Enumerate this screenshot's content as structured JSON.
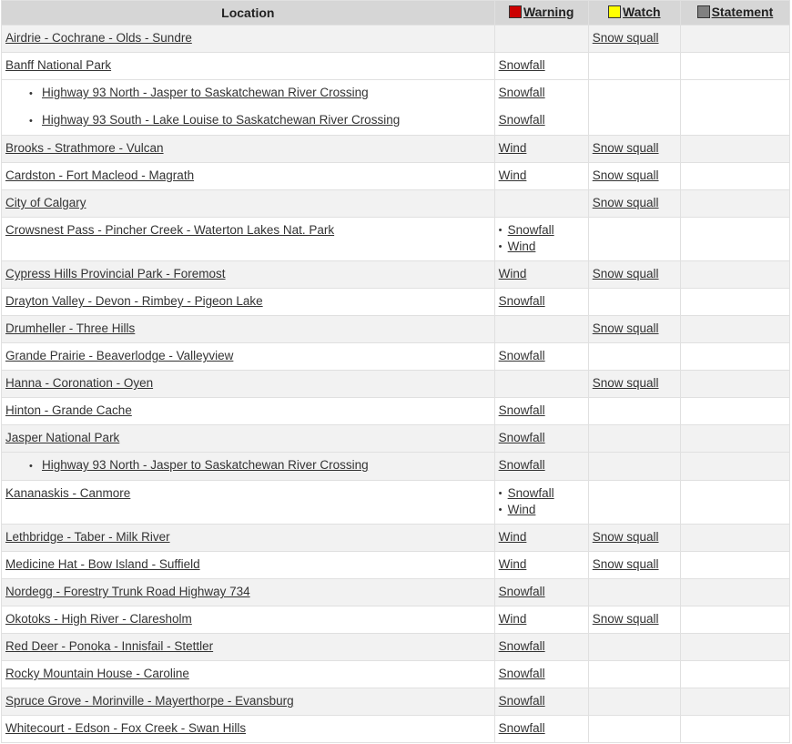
{
  "header": {
    "location": "Location",
    "warning": "Warning",
    "watch": "Watch",
    "statement": "Statement",
    "colors": {
      "warning": "#cc0000",
      "watch": "#ffff00",
      "statement": "#808080"
    }
  },
  "rows": [
    {
      "loc": "Airdrie - Cochrane - Olds - Sundre",
      "sub": false,
      "warning": [],
      "watch": [
        "Snow squall"
      ]
    },
    {
      "loc": "Banff National Park",
      "sub": false,
      "warning": [
        "Snowfall"
      ],
      "watch": []
    },
    {
      "loc": "Highway 93 North - Jasper to Saskatchewan River Crossing",
      "sub": true,
      "warning": [
        "Snowfall"
      ],
      "watch": []
    },
    {
      "loc": "Highway 93 South - Lake Louise to Saskatchewan River Crossing",
      "sub": true,
      "warning": [
        "Snowfall"
      ],
      "watch": []
    },
    {
      "loc": "Brooks - Strathmore - Vulcan",
      "sub": false,
      "warning": [
        "Wind"
      ],
      "watch": [
        "Snow squall"
      ]
    },
    {
      "loc": "Cardston - Fort Macleod - Magrath",
      "sub": false,
      "warning": [
        "Wind"
      ],
      "watch": [
        "Snow squall"
      ]
    },
    {
      "loc": "City of Calgary",
      "sub": false,
      "warning": [],
      "watch": [
        "Snow squall"
      ]
    },
    {
      "loc": "Crowsnest Pass - Pincher Creek - Waterton Lakes Nat. Park",
      "sub": false,
      "warning": [
        "Snowfall",
        "Wind"
      ],
      "watch": []
    },
    {
      "loc": "Cypress Hills Provincial Park - Foremost",
      "sub": false,
      "warning": [
        "Wind"
      ],
      "watch": [
        "Snow squall"
      ]
    },
    {
      "loc": "Drayton Valley - Devon - Rimbey - Pigeon Lake",
      "sub": false,
      "warning": [
        "Snowfall"
      ],
      "watch": []
    },
    {
      "loc": "Drumheller - Three Hills",
      "sub": false,
      "warning": [],
      "watch": [
        "Snow squall"
      ]
    },
    {
      "loc": "Grande Prairie - Beaverlodge - Valleyview",
      "sub": false,
      "warning": [
        "Snowfall"
      ],
      "watch": []
    },
    {
      "loc": "Hanna - Coronation - Oyen",
      "sub": false,
      "warning": [],
      "watch": [
        "Snow squall"
      ]
    },
    {
      "loc": "Hinton - Grande Cache",
      "sub": false,
      "warning": [
        "Snowfall"
      ],
      "watch": []
    },
    {
      "loc": "Jasper National Park",
      "sub": false,
      "warning": [
        "Snowfall"
      ],
      "watch": []
    },
    {
      "loc": "Highway 93 North - Jasper to Saskatchewan River Crossing",
      "sub": true,
      "warning": [
        "Snowfall"
      ],
      "watch": []
    },
    {
      "loc": "Kananaskis - Canmore",
      "sub": false,
      "warning": [
        "Snowfall",
        "Wind"
      ],
      "watch": []
    },
    {
      "loc": "Lethbridge - Taber - Milk River",
      "sub": false,
      "warning": [
        "Wind"
      ],
      "watch": [
        "Snow squall"
      ]
    },
    {
      "loc": "Medicine Hat - Bow Island - Suffield",
      "sub": false,
      "warning": [
        "Wind"
      ],
      "watch": [
        "Snow squall"
      ]
    },
    {
      "loc": "Nordegg - Forestry Trunk Road Highway 734",
      "sub": false,
      "warning": [
        "Snowfall"
      ],
      "watch": []
    },
    {
      "loc": "Okotoks - High River - Claresholm",
      "sub": false,
      "warning": [
        "Wind"
      ],
      "watch": [
        "Snow squall"
      ]
    },
    {
      "loc": "Red Deer - Ponoka - Innisfail - Stettler",
      "sub": false,
      "warning": [
        "Snowfall"
      ],
      "watch": []
    },
    {
      "loc": "Rocky Mountain House - Caroline",
      "sub": false,
      "warning": [
        "Snowfall"
      ],
      "watch": []
    },
    {
      "loc": "Spruce Grove - Morinville - Mayerthorpe - Evansburg",
      "sub": false,
      "warning": [
        "Snowfall"
      ],
      "watch": []
    },
    {
      "loc": "Whitecourt - Edson - Fox Creek - Swan Hills",
      "sub": false,
      "warning": [
        "Snowfall"
      ],
      "watch": []
    }
  ]
}
